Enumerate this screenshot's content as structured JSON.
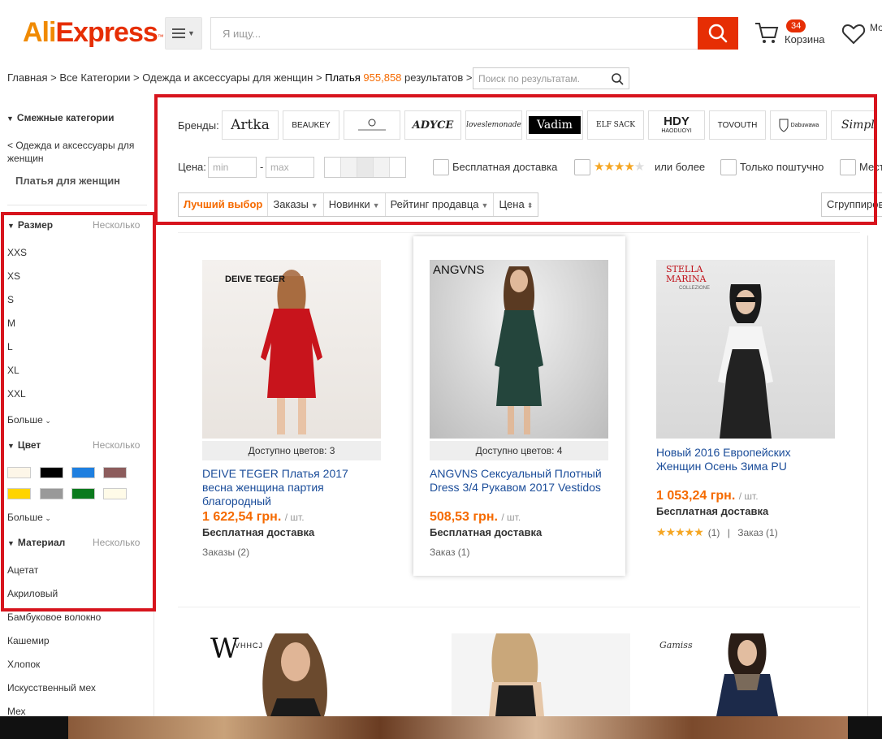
{
  "header": {
    "logo_ali": "Ali",
    "logo_express": "Express",
    "logo_tm": "™",
    "search_placeholder": "Я ищу...",
    "cart_count": "34",
    "cart_label": "Корзина",
    "wishlist_label": "Мо же"
  },
  "breadcrumb": {
    "home": "Главная",
    "sep": ">",
    "all_categories": "Все Категории",
    "women": "Одежда и аксессуары для женщин",
    "current": "Платья",
    "count": "955,858",
    "results": "результатов",
    "search_placeholder": "Поиск по результатам."
  },
  "sidebar": {
    "related_title": "Смежные категории",
    "related_parent": "< Одежда и аксессуары для женщин",
    "related_current": "Платья для женщин",
    "size": {
      "title": "Размер",
      "multi": "Несколько",
      "options": [
        "XXS",
        "XS",
        "S",
        "M",
        "L",
        "XL",
        "XXL"
      ],
      "more": "Больше"
    },
    "color": {
      "title": "Цвет",
      "multi": "Несколько",
      "swatches": [
        "#fdf6e8",
        "#000000",
        "#1e7fe0",
        "#8c5c5c",
        "#ffd400",
        "#999999",
        "#0b7a1e",
        "#fffbe8"
      ],
      "more": "Больше"
    },
    "material": {
      "title": "Материал",
      "multi": "Несколько",
      "options": [
        "Ацетат",
        "Акриловый",
        "Бамбуковое волокно",
        "Кашемир",
        "Хлопок",
        "Искусственный мех",
        "Мех"
      ]
    }
  },
  "filters": {
    "brands_label": "Бренды:",
    "brands": [
      "Artka",
      "BEAUKEY",
      "",
      "ADYCE",
      "loveslemonade",
      "Vadim",
      "ELF SACK",
      "HDY",
      "TOVOUTH",
      "",
      "Simplee"
    ],
    "brand_sub_hdy": "HAODUOYI",
    "brand_sub_dabuwawa": "Dabuwawa",
    "price_label": "Цена:",
    "price_min": "min",
    "price_dash": "-",
    "price_max": "max",
    "free_shipping": "Бесплатная доставка",
    "rating_suffix": "или более",
    "rating_value": 4,
    "single_piece": "Только поштучно",
    "local": "Мест",
    "sort": [
      "Лучший выбор",
      "Заказы",
      "Новинки",
      "Рейтинг продавца",
      "Цена"
    ],
    "group": "Сгруппиров"
  },
  "products": [
    {
      "brand_img": "DEIVE TEGER",
      "colors": "Доступно цветов: 3",
      "title": "DEIVE TEGER Платья 2017 весна женщина партия благородный",
      "price": "1 622,54 грн.",
      "unit": "/ шт.",
      "shipping": "Бесплатная доставка",
      "orders": "Заказы (2)"
    },
    {
      "brand_img": "ANGVNS",
      "colors": "Доступно цветов: 4",
      "title": "ANGVNS Сексуальный Плотный Dress 3/4 Рукавом 2017 Vestidos",
      "price": "508,53 грн.",
      "unit": "/ шт.",
      "shipping": "Бесплатная доставка",
      "orders": "Заказ (1)"
    },
    {
      "brand_img": "STELLA MARINA",
      "brand_img_sub": "COLLEZIONE",
      "title": "Новый 2016 Европейских Женщин Осень Зима PU",
      "price": "1 053,24 грн.",
      "unit": "/ шт.",
      "shipping": "Бесплатная доставка",
      "rating": "(1)",
      "rating_sep": "|",
      "orders": "Заказ (1)"
    }
  ],
  "products_row2": [
    {
      "brand_img": "VHHCJ"
    },
    {
      "brand_img": ""
    },
    {
      "brand_img": "Gamiss"
    }
  ],
  "colors": {
    "accent": "#e62e04",
    "orange": "#f56a00",
    "link": "#1a4c99",
    "highlight": "#d7141d"
  }
}
